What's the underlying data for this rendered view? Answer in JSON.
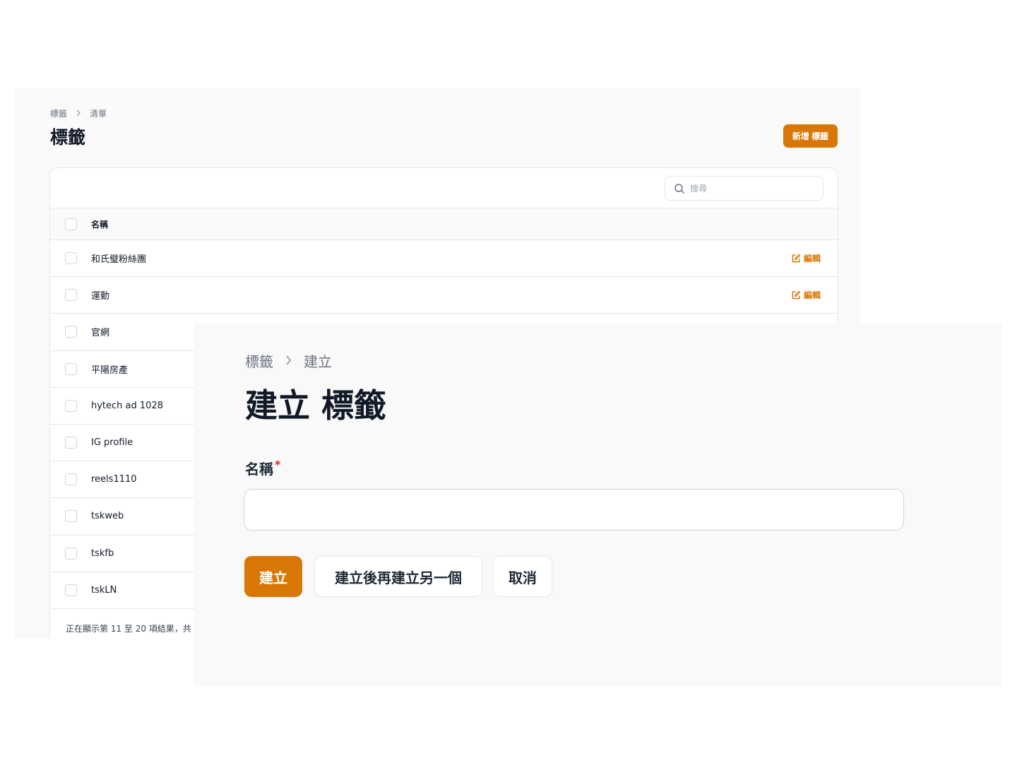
{
  "list_page": {
    "breadcrumb": [
      "標籤",
      "清單"
    ],
    "breadcrumb_separator": ">",
    "title": "標籤",
    "new_button_label": "新增 標籤",
    "search_placeholder": "搜尋",
    "column_header": "名稱",
    "edit_label": "編輯",
    "rows": [
      {
        "name": "和氏璧粉絲團",
        "editable": true
      },
      {
        "name": "運動",
        "editable": true
      },
      {
        "name": "官網",
        "editable": false
      },
      {
        "name": "平陽房產",
        "editable": false
      },
      {
        "name": "hytech ad 1028",
        "editable": false
      },
      {
        "name": "IG profile",
        "editable": false
      },
      {
        "name": "reels1110",
        "editable": false
      },
      {
        "name": "tskweb",
        "editable": false
      },
      {
        "name": "tskfb",
        "editable": false
      },
      {
        "name": "tskLN",
        "editable": false
      }
    ],
    "pagination_text": "正在顯示第 11 至 20 項結果，共"
  },
  "create_page": {
    "breadcrumb": [
      "標籤",
      "建立"
    ],
    "breadcrumb_separator": ">",
    "title": "建立 標籤",
    "field_label": "名稱",
    "required_mark": "*",
    "field_value": "",
    "create_button": "建立",
    "create_another_button": "建立後再建立另一個",
    "cancel_button": "取消"
  },
  "colors": {
    "primary": "#d97706",
    "required": "#dc2626"
  }
}
